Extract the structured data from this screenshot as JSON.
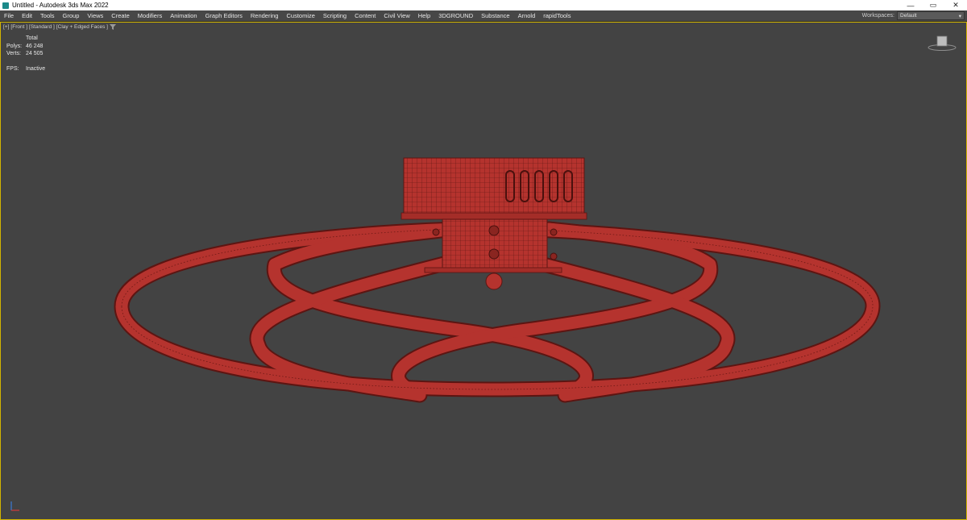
{
  "window": {
    "title": "Untitled - Autodesk 3ds Max 2022",
    "controls": {
      "minimize": "—",
      "maximize": "▭",
      "close": "✕"
    }
  },
  "menubar": {
    "items": [
      "File",
      "Edit",
      "Tools",
      "Group",
      "Views",
      "Create",
      "Modifiers",
      "Animation",
      "Graph Editors",
      "Rendering",
      "Customize",
      "Scripting",
      "Content",
      "Civil View",
      "Help",
      "3DGROUND",
      "Substance",
      "Arnold",
      "rapidTools"
    ],
    "workspaces_label": "Workspaces:",
    "workspaces_value": "Default"
  },
  "viewport": {
    "label_plus": "[+]",
    "label_view": "[Front ]",
    "label_style": "[Standard ]",
    "label_shading": "[Clay + Edged Faces ]",
    "stats": {
      "total_label": "Total",
      "polys_label": "Polys:",
      "polys_value": "46 248",
      "verts_label": "Verts:",
      "verts_value": "24 505",
      "fps_label": "FPS:",
      "fps_value": "Inactive"
    }
  },
  "icons": [
    "filter-icon",
    "viewcube-icon",
    "axis-tripod-icon"
  ],
  "colors": {
    "model": "#b5332e",
    "model_edge": "#5c1512",
    "viewport_border": "#d2b400",
    "viewport_bg": "#434343"
  }
}
